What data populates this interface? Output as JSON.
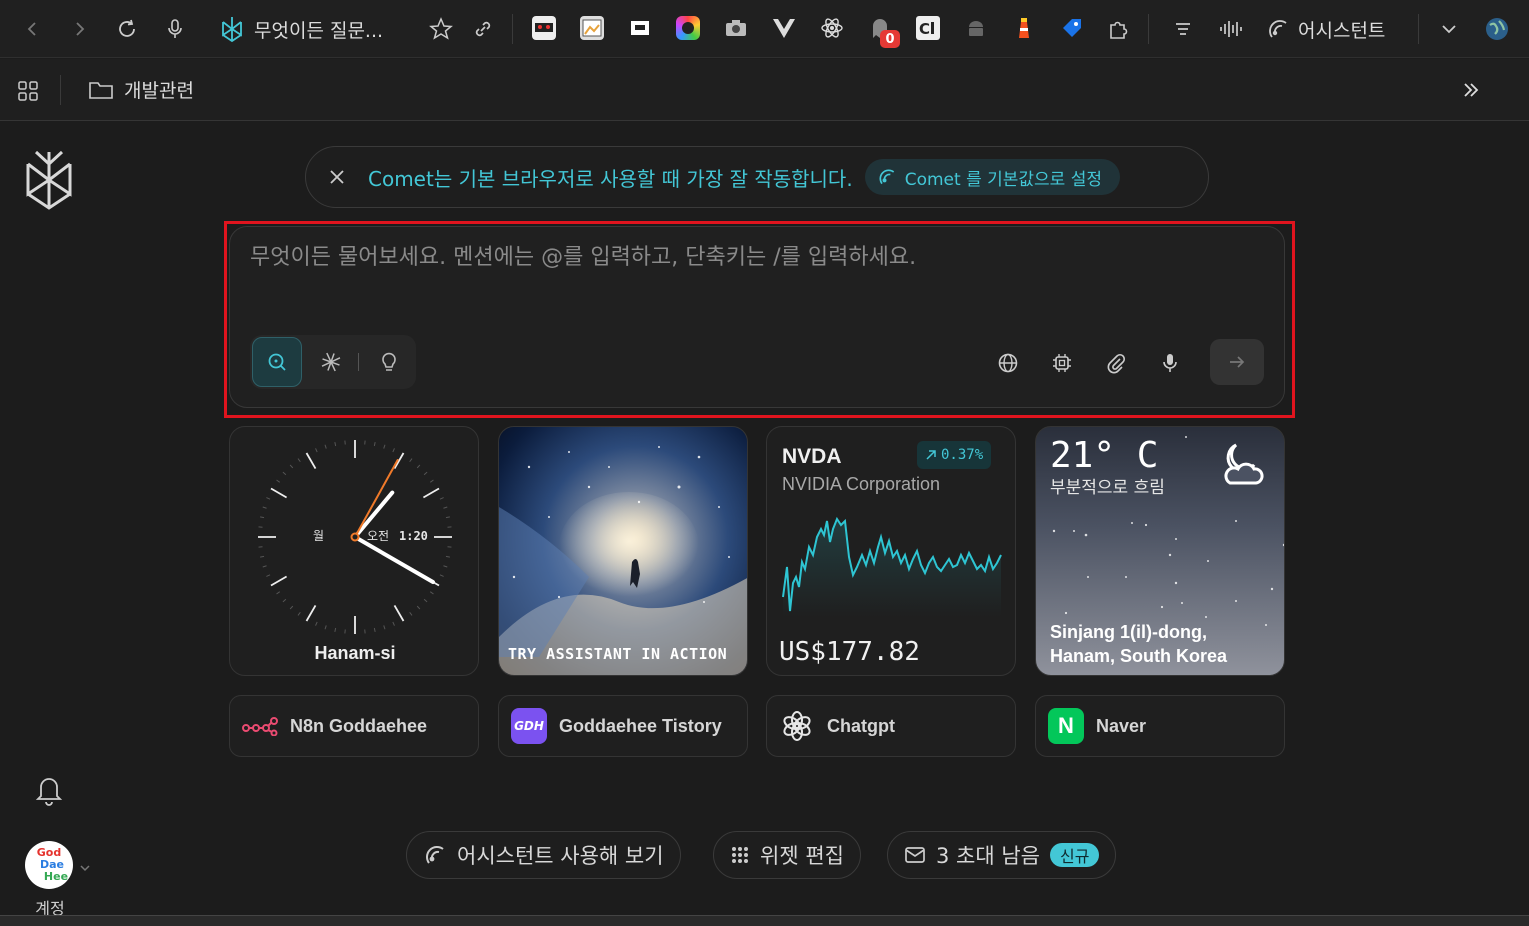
{
  "toolbar": {
    "tab_title": "무엇이든 질문...",
    "extension_badge_count": "0",
    "assistant_label": "어시스턴트"
  },
  "bookmarks": {
    "folder_label": "개발관련"
  },
  "banner": {
    "message": "Comet는 기본 브라우저로 사용할 때 가장 잘 작동합니다.",
    "button_label": "Comet 를 기본값으로 설정"
  },
  "search": {
    "placeholder": "무엇이든 물어보세요. 멘션에는 @를 입력하고, 단축키는 /를 입력하세요."
  },
  "widgets": {
    "clock": {
      "weekday": "월",
      "ampm": "오전",
      "time": "1:20",
      "city": "Hanam-si"
    },
    "promo": {
      "text": "TRY ASSISTANT IN ACTION"
    },
    "stock": {
      "symbol": "NVDA",
      "name": "NVIDIA Corporation",
      "change": "0.37%",
      "price": "US$177.82",
      "color": "#2ec5d3"
    },
    "weather": {
      "temp": "21° C",
      "condition": "부분적으로 흐림",
      "location": "Sinjang 1(il)-dong, Hanam, South Korea"
    }
  },
  "shortcuts": [
    {
      "label": "N8n Goddaehee",
      "icon": "n8n-icon"
    },
    {
      "label": "Goddaehee Tistory",
      "icon": "gdh-icon",
      "icon_text": "GDH"
    },
    {
      "label": "Chatgpt",
      "icon": "chatgpt-icon"
    },
    {
      "label": "Naver",
      "icon": "naver-icon",
      "icon_text": "N"
    }
  ],
  "bottom": {
    "try_assistant": "어시스턴트 사용해 보기",
    "edit_widgets": "위젯 편집",
    "invites": "3 초대 남음",
    "new_badge": "신규"
  },
  "account": {
    "label": "계정",
    "avatar_text": [
      "God",
      "Dae",
      "Hee"
    ]
  },
  "colors": {
    "accent": "#43c7d6",
    "highlight": "#e0141e",
    "background": "#1c1c1c"
  }
}
